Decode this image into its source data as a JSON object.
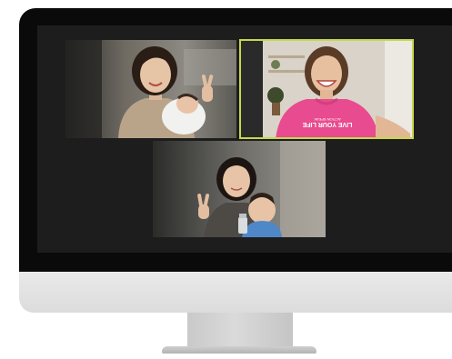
{
  "meeting": {
    "participants": [
      {
        "tile": 1,
        "active_speaker": false
      },
      {
        "tile": 2,
        "active_speaker": true,
        "shirt_text": "LIVE YOUR LIFE",
        "shirt_subtext": "ACTION SPEAK"
      },
      {
        "tile": 3,
        "active_speaker": false
      }
    ]
  },
  "colors": {
    "bezel": "#0a0a0a",
    "screen_background": "#1d1d1d",
    "active_speaker_outline": "#c7d84a",
    "shirt_pink": "#e84b8f",
    "chin": "#e3e3e3",
    "stand": "#cccccc"
  }
}
